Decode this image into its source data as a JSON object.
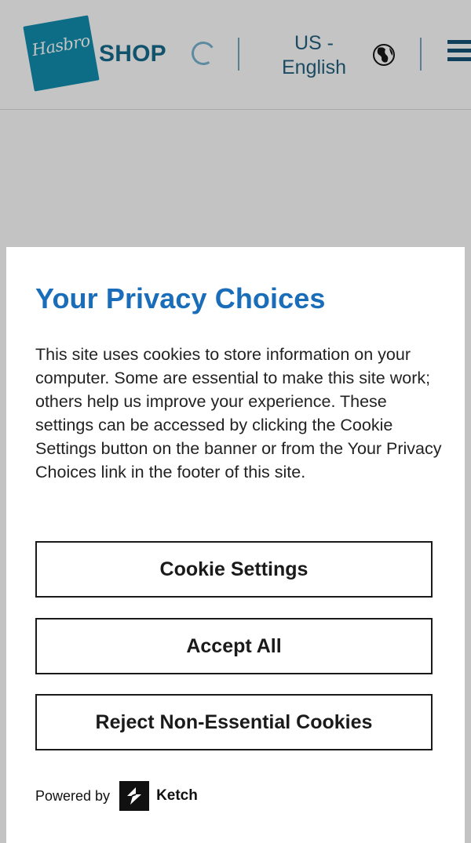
{
  "header": {
    "logo_text": "Hasbro",
    "shop_label": "SHOP",
    "locale_line1": "US -",
    "locale_line2": "English",
    "icons": [
      "globe-icon",
      "menu-icon",
      "loading-spinner-icon"
    ]
  },
  "privacy": {
    "title": "Your Privacy Choices",
    "body": "This site uses cookies to store information on your computer. Some are essential to make this site work; others help us improve your experience. These settings can be accessed by clicking the Cookie Settings button on the banner or from the Your Privacy Choices link in the footer of this site.",
    "buttons": {
      "cookie_settings": "Cookie Settings",
      "accept_all": "Accept All",
      "reject": "Reject Non-Essential Cookies"
    },
    "powered_by": "Powered by",
    "brand": "Ketch"
  },
  "colors": {
    "title_blue": "#1a6db8",
    "shop_blue": "#11526c",
    "overlay_gray": "#c3c3c3"
  }
}
